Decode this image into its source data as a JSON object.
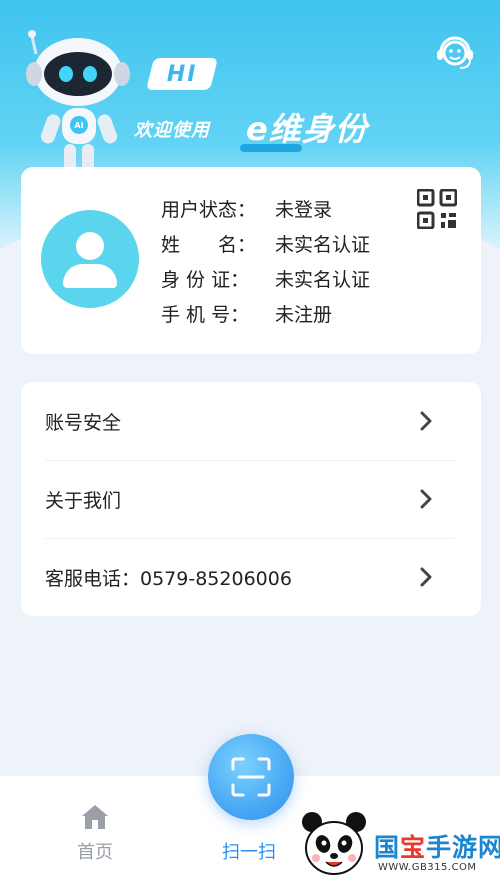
{
  "header": {
    "hi": "HI",
    "welcome": "欢迎使用",
    "brand": "e维身份",
    "robot_chest_text": "AI",
    "support_icon": "customer-service-icon"
  },
  "user_card": {
    "status_label": "用户状态：",
    "status_value": "未登录",
    "name_label": "姓　　名：",
    "name_value": "未实名认证",
    "id_label": "身 份 证：",
    "id_value": "未实名认证",
    "phone_label": "手 机 号：",
    "phone_value": "未注册",
    "avatar_icon": "user-avatar-icon",
    "qr_icon": "qr-code-icon"
  },
  "menu": {
    "items": [
      {
        "label": "账号安全"
      },
      {
        "label": "关于我们"
      },
      {
        "label": "客服电话：0579-85206006"
      }
    ]
  },
  "tabbar": {
    "home_label": "首页",
    "scan_label": "扫一扫"
  },
  "watermark": {
    "text_cn_1": "国",
    "text_cn_2": "宝",
    "text_cn_3": "手游网",
    "text_en": "WWW.GB315.COM"
  },
  "colors": {
    "header_top": "#3fc4ef",
    "accent_blue": "#2a8ff0",
    "avatar_bg": "#5bd4ee",
    "page_bg": "#eef2f9"
  }
}
